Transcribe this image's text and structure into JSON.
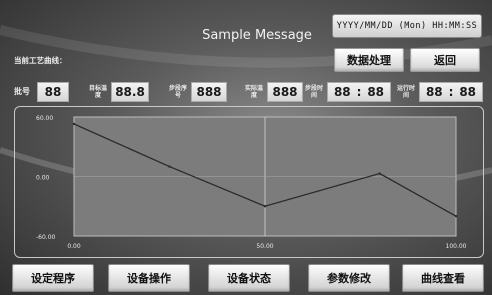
{
  "header": {
    "title": "Sample Message",
    "datetime": "YYYY/MM/DD (Mon) HH:MM:SS"
  },
  "curve_label": "当前工艺曲线：",
  "buttons_top": {
    "data_process": "数据处理",
    "back": "返回"
  },
  "info": {
    "no_label": "批号",
    "no_value": "88",
    "target_temp_label": "目标温度",
    "target_temp_value": "88.8",
    "step_no_label": "步段序号",
    "step_no_value": "888",
    "actual_temp_label": "实际温度",
    "actual_temp_value": "888",
    "step_time_label": "步段时间",
    "step_time_h": "88",
    "step_time_m": "88",
    "run_time_label": "运行时间",
    "run_time_h": "88",
    "run_time_m": "88",
    "colon": ":"
  },
  "chart_data": {
    "type": "line",
    "x": [
      0,
      25,
      50,
      80,
      100
    ],
    "series": [
      {
        "values": [
          53,
          10,
          -30,
          3,
          -40
        ]
      }
    ],
    "xlim": [
      0,
      100
    ],
    "ylim": [
      -60,
      60
    ],
    "x_ticks": [
      "0.00",
      "50.00",
      "100.00"
    ],
    "y_ticks": [
      "60.00",
      "0.00",
      "-60.00"
    ],
    "grid": true,
    "line_color": "#2a2a2a"
  },
  "bottom_nav": [
    {
      "label": "设定程序"
    },
    {
      "label": "设备操作"
    },
    {
      "label": "设备状态"
    },
    {
      "label": "参数修改"
    },
    {
      "label": "曲线查看"
    }
  ]
}
